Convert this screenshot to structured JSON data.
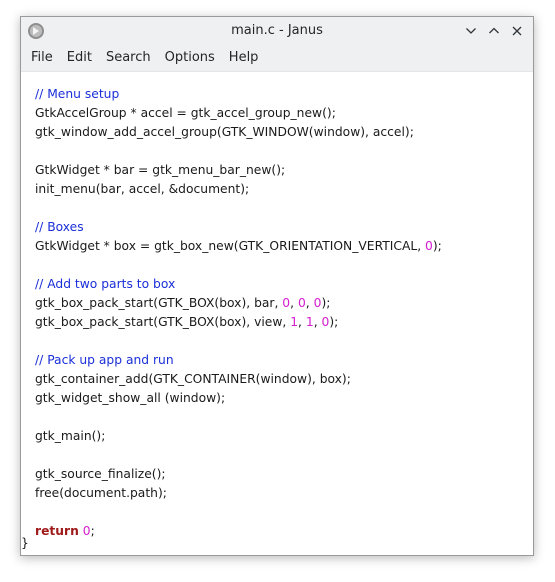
{
  "window": {
    "title": "main.c - Janus"
  },
  "titlebar_buttons": {
    "minimize_icon": "chevron-down-icon",
    "maximize_icon": "chevron-up-icon",
    "close_icon": "close-icon"
  },
  "menu": [
    "File",
    "Edit",
    "Search",
    "Options",
    "Help"
  ],
  "colors": {
    "comment": "#1a2fd8",
    "number": "#d51ed1",
    "keyword": "#a01a1a",
    "text": "#1a1a1a"
  },
  "code_lines": [
    [
      {
        "t": "comment",
        "v": "// Menu setup"
      }
    ],
    [
      {
        "t": "plain",
        "v": "GtkAccelGroup * accel = gtk_accel_group_new();"
      }
    ],
    [
      {
        "t": "plain",
        "v": "gtk_window_add_accel_group(GTK_WINDOW(window), accel);"
      }
    ],
    [],
    [
      {
        "t": "plain",
        "v": "GtkWidget * bar = gtk_menu_bar_new();"
      }
    ],
    [
      {
        "t": "plain",
        "v": "init_menu(bar, accel, &document);"
      }
    ],
    [],
    [
      {
        "t": "comment",
        "v": "// Boxes"
      }
    ],
    [
      {
        "t": "plain",
        "v": "GtkWidget * box = gtk_box_new(GTK_ORIENTATION_VERTICAL, "
      },
      {
        "t": "number",
        "v": "0"
      },
      {
        "t": "plain",
        "v": ");"
      }
    ],
    [],
    [
      {
        "t": "comment",
        "v": "// Add two parts to box"
      }
    ],
    [
      {
        "t": "plain",
        "v": "gtk_box_pack_start(GTK_BOX(box), bar, "
      },
      {
        "t": "number",
        "v": "0"
      },
      {
        "t": "plain",
        "v": ", "
      },
      {
        "t": "number",
        "v": "0"
      },
      {
        "t": "plain",
        "v": ", "
      },
      {
        "t": "number",
        "v": "0"
      },
      {
        "t": "plain",
        "v": ");"
      }
    ],
    [
      {
        "t": "plain",
        "v": "gtk_box_pack_start(GTK_BOX(box), view, "
      },
      {
        "t": "number",
        "v": "1"
      },
      {
        "t": "plain",
        "v": ", "
      },
      {
        "t": "number",
        "v": "1"
      },
      {
        "t": "plain",
        "v": ", "
      },
      {
        "t": "number",
        "v": "0"
      },
      {
        "t": "plain",
        "v": ");"
      }
    ],
    [],
    [
      {
        "t": "comment",
        "v": "// Pack up app and run"
      }
    ],
    [
      {
        "t": "plain",
        "v": "gtk_container_add(GTK_CONTAINER(window), box);"
      }
    ],
    [
      {
        "t": "plain",
        "v": "gtk_widget_show_all (window);"
      }
    ],
    [],
    [
      {
        "t": "plain",
        "v": "gtk_main();"
      }
    ],
    [],
    [
      {
        "t": "plain",
        "v": "gtk_source_finalize();"
      }
    ],
    [
      {
        "t": "plain",
        "v": "free(document.path);"
      }
    ],
    [],
    [
      {
        "t": "keyword",
        "v": "return"
      },
      {
        "t": "plain",
        "v": " "
      },
      {
        "t": "number",
        "v": "0"
      },
      {
        "t": "plain",
        "v": ";"
      }
    ]
  ],
  "closing_brace": "}"
}
